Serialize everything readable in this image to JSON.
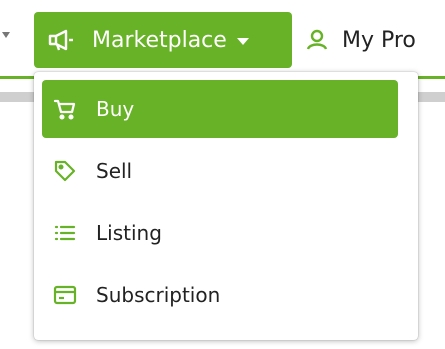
{
  "nav": {
    "marketplace_label": "Marketplace",
    "marketplace_icon": "megaphone-icon",
    "profile_label": "My Pro",
    "profile_icon": "user-icon"
  },
  "dropdown": {
    "items": [
      {
        "label": "Buy",
        "icon": "cart-icon",
        "active": true
      },
      {
        "label": "Sell",
        "icon": "tag-icon",
        "active": false
      },
      {
        "label": "Listing",
        "icon": "list-icon",
        "active": false
      },
      {
        "label": "Subscription",
        "icon": "card-icon",
        "active": false
      }
    ]
  },
  "colors": {
    "accent": "#67b226",
    "text": "#222222",
    "gray_strip": "#cfcfcf"
  }
}
